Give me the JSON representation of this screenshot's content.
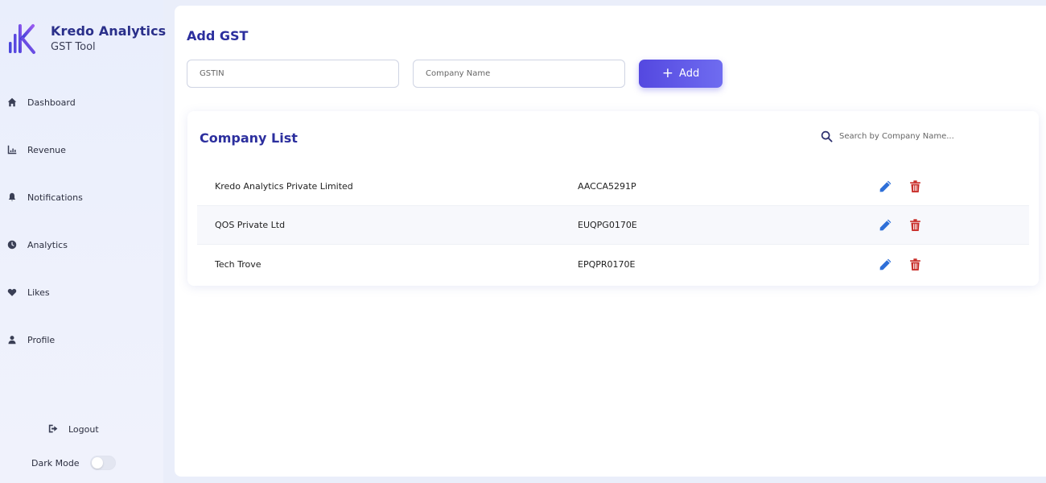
{
  "brand": {
    "title": "Kredo Analytics",
    "subtitle": "GST Tool",
    "logo_colors": [
      "#3b3fd6",
      "#6a4de6",
      "#8a5cf0"
    ]
  },
  "sidebar": {
    "items": [
      {
        "label": "Dashboard",
        "icon": "home-icon"
      },
      {
        "label": "Revenue",
        "icon": "chart-icon"
      },
      {
        "label": "Notifications",
        "icon": "bell-icon"
      },
      {
        "label": "Analytics",
        "icon": "clock-icon"
      },
      {
        "label": "Likes",
        "icon": "heart-icon"
      },
      {
        "label": "Profile",
        "icon": "user-icon"
      }
    ],
    "logout_label": "Logout",
    "dark_mode_label": "Dark Mode",
    "dark_mode_on": false
  },
  "add_gst": {
    "title": "Add GST",
    "gstin_placeholder": "GSTIN",
    "company_placeholder": "Company Name",
    "add_label": "Add"
  },
  "company_list": {
    "title": "Company List",
    "search_placeholder": "Search by Company Name...",
    "rows": [
      {
        "name": "Kredo Analytics Private Limited",
        "gstin": "AACCA5291P"
      },
      {
        "name": "QOS Private Ltd",
        "gstin": "EUQPG0170E"
      },
      {
        "name": "Tech Trove",
        "gstin": "EPQPR0170E"
      }
    ]
  },
  "colors": {
    "accent": "#2c2f9e",
    "button": "#5a4fe4",
    "edit": "#2e6fd8",
    "delete": "#c9302c"
  }
}
